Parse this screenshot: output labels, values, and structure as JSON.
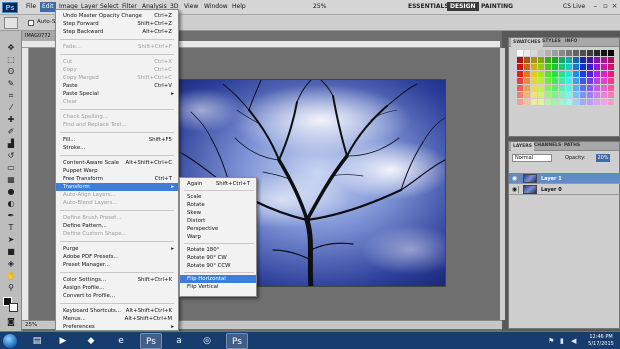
{
  "menubar": {
    "logo": "Ps",
    "items": [
      "File",
      "Edit",
      "Image",
      "Layer",
      "Select",
      "Filter",
      "Analysis",
      "3D",
      "View",
      "Window",
      "Help"
    ],
    "active_item": "Edit",
    "zoom": "25%",
    "workspaces": [
      "ESSENTIALS",
      "DESIGN",
      "PAINTING"
    ],
    "active_workspace": "DESIGN",
    "cs_live": "CS Live"
  },
  "options_bar": {
    "auto_select_label": "Auto-S"
  },
  "document": {
    "tab_title": "IMAG0772",
    "zoom_status": "25%"
  },
  "edit_menu": {
    "items": [
      {
        "label": "Undo Master Opacity Change",
        "shortcut": "Ctrl+Z",
        "disabled": false
      },
      {
        "label": "Step Forward",
        "shortcut": "Shift+Ctrl+Z",
        "disabled": false
      },
      {
        "label": "Step Backward",
        "shortcut": "Alt+Ctrl+Z",
        "disabled": false
      },
      {
        "label": "Fade...",
        "shortcut": "Shift+Ctrl+F",
        "disabled": true
      },
      {
        "label": "Cut",
        "shortcut": "Ctrl+X",
        "disabled": true
      },
      {
        "label": "Copy",
        "shortcut": "Ctrl+C",
        "disabled": true
      },
      {
        "label": "Copy Merged",
        "shortcut": "Shift+Ctrl+C",
        "disabled": true
      },
      {
        "label": "Paste",
        "shortcut": "Ctrl+V",
        "disabled": false
      },
      {
        "label": "Paste Special",
        "shortcut": "",
        "disabled": false,
        "submenu": true
      },
      {
        "label": "Clear",
        "shortcut": "",
        "disabled": true
      },
      {
        "label": "Check Spelling...",
        "shortcut": "",
        "disabled": true
      },
      {
        "label": "Find and Replace Text...",
        "shortcut": "",
        "disabled": true
      },
      {
        "label": "Fill...",
        "shortcut": "Shift+F5",
        "disabled": false
      },
      {
        "label": "Stroke...",
        "shortcut": "",
        "disabled": false
      },
      {
        "label": "Content-Aware Scale",
        "shortcut": "Alt+Shift+Ctrl+C",
        "disabled": false
      },
      {
        "label": "Puppet Warp",
        "shortcut": "",
        "disabled": false
      },
      {
        "label": "Free Transform",
        "shortcut": "Ctrl+T",
        "disabled": false
      },
      {
        "label": "Transform",
        "shortcut": "",
        "disabled": false,
        "submenu": true,
        "highlighted": true
      },
      {
        "label": "Auto-Align Layers...",
        "shortcut": "",
        "disabled": true
      },
      {
        "label": "Auto-Blend Layers...",
        "shortcut": "",
        "disabled": true
      },
      {
        "label": "Define Brush Preset...",
        "shortcut": "",
        "disabled": true
      },
      {
        "label": "Define Pattern...",
        "shortcut": "",
        "disabled": false
      },
      {
        "label": "Define Custom Shape...",
        "shortcut": "",
        "disabled": true
      },
      {
        "label": "Purge",
        "shortcut": "",
        "disabled": false,
        "submenu": true
      },
      {
        "label": "Adobe PDF Presets...",
        "shortcut": "",
        "disabled": false
      },
      {
        "label": "Preset Manager...",
        "shortcut": "",
        "disabled": false
      },
      {
        "label": "Color Settings...",
        "shortcut": "Shift+Ctrl+K",
        "disabled": false
      },
      {
        "label": "Assign Profile...",
        "shortcut": "",
        "disabled": false
      },
      {
        "label": "Convert to Profile...",
        "shortcut": "",
        "disabled": false
      },
      {
        "label": "Keyboard Shortcuts...",
        "shortcut": "Alt+Shift+Ctrl+K",
        "disabled": false
      },
      {
        "label": "Menus...",
        "shortcut": "Alt+Shift+Ctrl+M",
        "disabled": false
      },
      {
        "label": "Preferences",
        "shortcut": "",
        "disabled": false,
        "submenu": true
      }
    ]
  },
  "transform_submenu": {
    "items": [
      {
        "label": "Again",
        "shortcut": "Shift+Ctrl+T",
        "highlighted": false
      },
      {
        "label": "Scale",
        "shortcut": "",
        "highlighted": false
      },
      {
        "label": "Rotate",
        "shortcut": "",
        "highlighted": false
      },
      {
        "label": "Skew",
        "shortcut": "",
        "highlighted": false
      },
      {
        "label": "Distort",
        "shortcut": "",
        "highlighted": false
      },
      {
        "label": "Perspective",
        "shortcut": "",
        "highlighted": false
      },
      {
        "label": "Warp",
        "shortcut": "",
        "highlighted": false
      },
      {
        "label": "Rotate 180°",
        "shortcut": "",
        "highlighted": false
      },
      {
        "label": "Rotate 90° CW",
        "shortcut": "",
        "highlighted": false
      },
      {
        "label": "Rotate 90° CCW",
        "shortcut": "",
        "highlighted": false
      },
      {
        "label": "Flip Horizontal",
        "shortcut": "",
        "highlighted": true
      },
      {
        "label": "Flip Vertical",
        "shortcut": "",
        "highlighted": false
      }
    ]
  },
  "swatches_panel": {
    "tabs": [
      "SWATCHES",
      "STYLES",
      "INFO"
    ],
    "active_tab": "SWATCHES"
  },
  "layers_panel": {
    "tabs": [
      "LAYERS",
      "CHANNELS",
      "PATHS"
    ],
    "active_tab": "LAYERS",
    "blend_mode": "Normal",
    "opacity_label": "Opacity:",
    "opacity_value": "20%",
    "layers": [
      {
        "name": "Layer 1",
        "selected": true
      },
      {
        "name": "Layer 0",
        "selected": false
      }
    ]
  },
  "taskbar": {
    "apps": [
      "explorer",
      "media-player",
      "dropbox",
      "internet-explorer",
      "photoshop",
      "amazon",
      "chrome",
      "photoshop"
    ],
    "time": "12:46 PM",
    "date": "5/17/2015"
  },
  "colors": {
    "menu_highlight": "#3d7ed8",
    "layer_selected": "#5f8cc8",
    "taskbar": "#173c6e"
  }
}
